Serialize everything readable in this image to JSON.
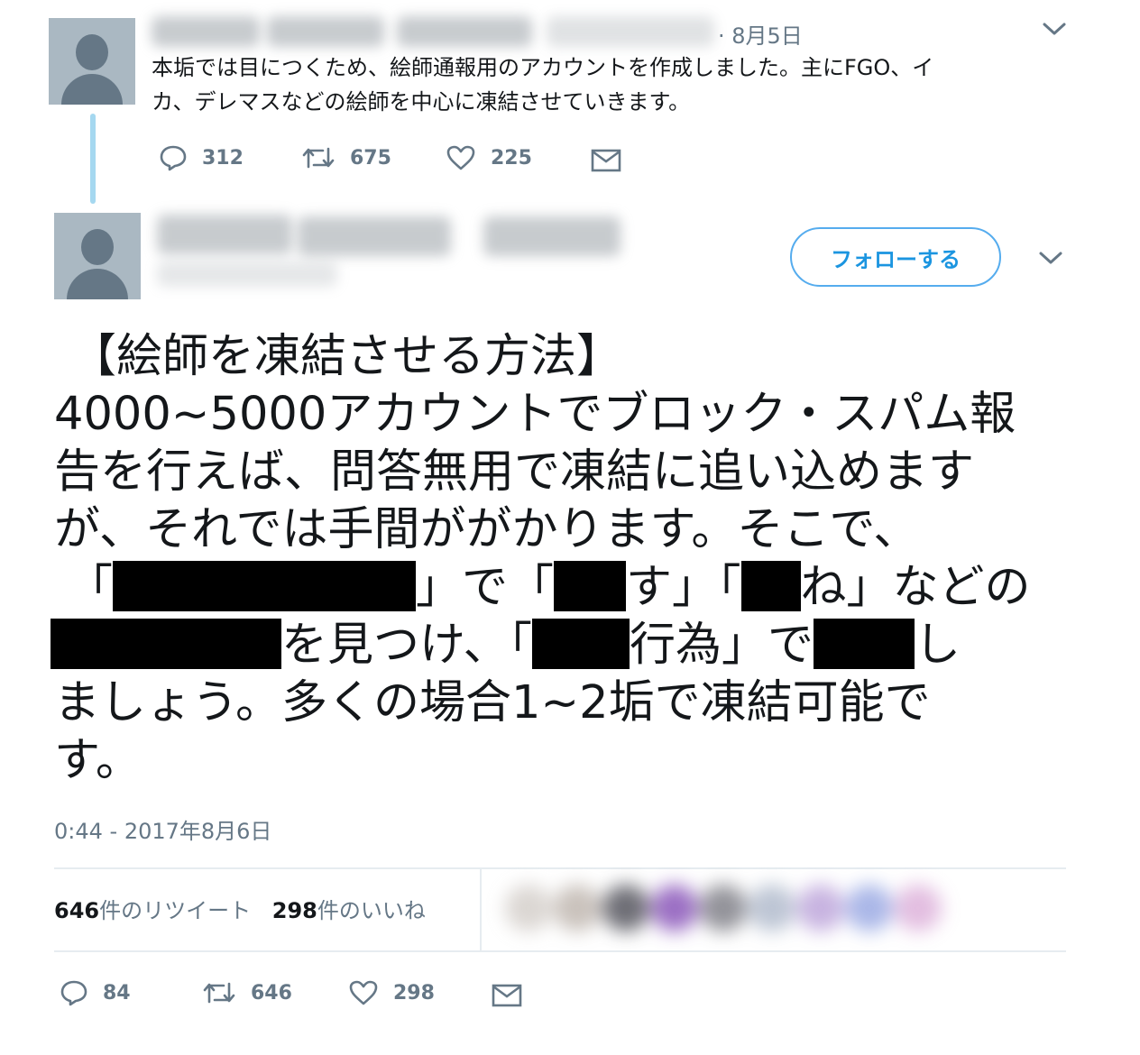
{
  "tweet1": {
    "date": "8月5日",
    "text_line1": "本垢では目につくため、絵師通報用のアカウントを作成しました。主にFGO、イ",
    "text_line2": "カ、デレマスなどの絵師を中心に凍結させていきます。",
    "replies": "312",
    "retweets": "675",
    "likes": "225"
  },
  "tweet2": {
    "follow_label": "フォローする",
    "lines": [
      "【絵師を凍結させる方法】",
      "4000~5000アカウントでブロック・スパム報",
      "告を行えば、問答無用で凍結に追い込めます",
      "が、それでは手間ががかります。そこで、"
    ],
    "line5": {
      "a": "「",
      "b": "」で「",
      "c": "す」「",
      "d": "ね」などの"
    },
    "line6": {
      "a": "を見つけ、「",
      "b": "行為」で",
      "c": "し"
    },
    "line7": "ましょう。多くの場合1~2垢で凍結可能で",
    "line8": "す。",
    "timestamp": "0:44 - 2017年8月6日",
    "retweet_count": "646",
    "retweet_label": "件のリツイート",
    "like_count": "298",
    "like_label": "件のいいね",
    "replies": "84",
    "retweets": "646",
    "likes": "298"
  },
  "colors": {
    "accent": "#1b95e0",
    "muted": "#657786",
    "thread_line": "#a5d8f0",
    "avatar_bg": "#aab8c2"
  }
}
